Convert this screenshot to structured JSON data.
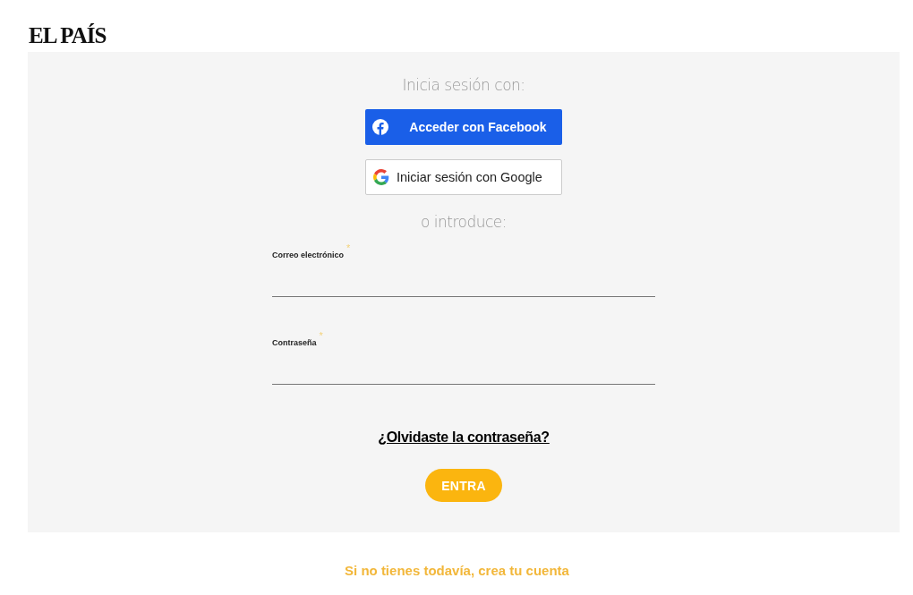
{
  "logo": "EL PAÍS",
  "login": {
    "heading": "Inicia sesión con:",
    "social_buttons": [
      {
        "kind": "facebook",
        "label": "Acceder con Facebook"
      },
      {
        "kind": "google",
        "label": "Iniciar sesión con Google"
      }
    ],
    "divider_text": "o introduce:",
    "fields": [
      {
        "label": "Correo electrónico",
        "required_mark": "*"
      },
      {
        "label": "Contraseña",
        "required_mark": "*"
      }
    ],
    "forgot_link": "¿Olvidaste la contraseña?",
    "submit": "ENTRA"
  },
  "register_link": "Si no tienes todavía, crea tu cuenta"
}
